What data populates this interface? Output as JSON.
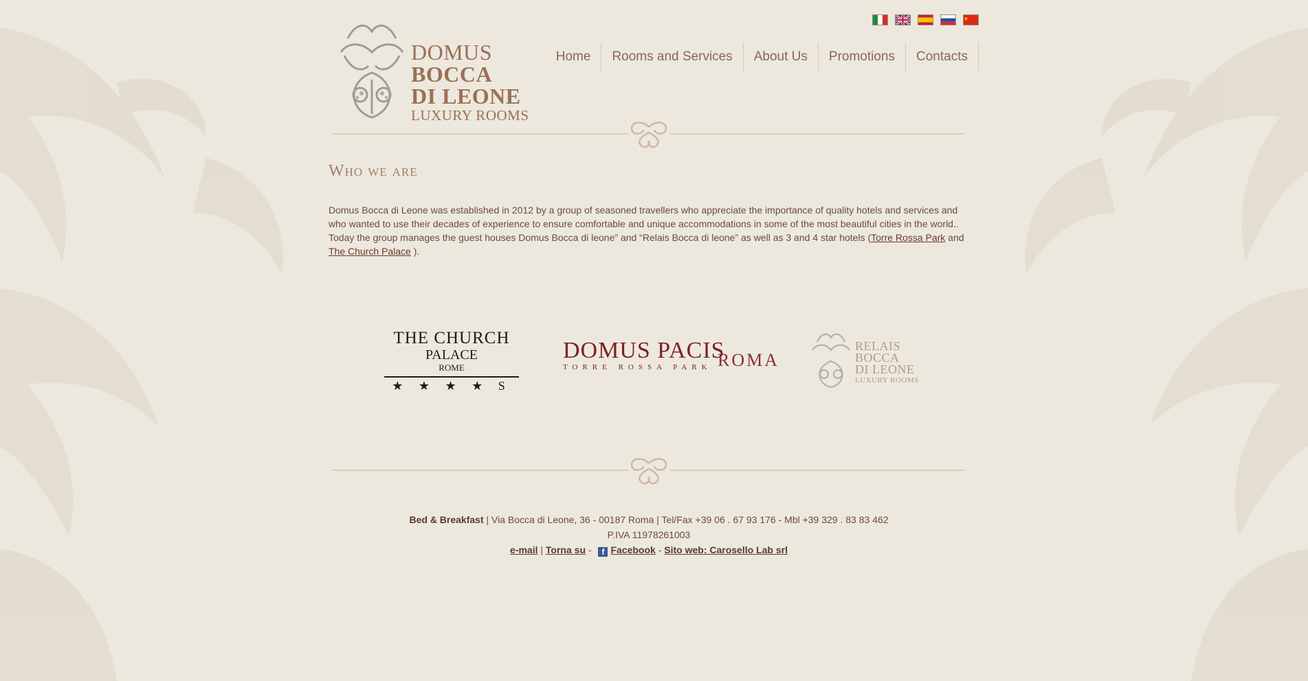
{
  "logo": {
    "line1": "DOMUS",
    "line2": "BOCCA",
    "line3": "DI LEONE",
    "line4": "LUXURY ROOMS"
  },
  "languages": [
    "Italiano",
    "English",
    "Español",
    "Русский",
    "中文"
  ],
  "nav": {
    "items": [
      "Home",
      "Rooms and Services",
      "About Us",
      "Promotions",
      "Contacts"
    ]
  },
  "about": {
    "heading": "Who we are",
    "text_1": "Domus Bocca di Leone was established in 2012 by a group of seasoned travellers who appreciate the importance of quality hotels and services and who wanted to use their decades of experience to ensure comfortable and unique accommodations in some of the most beautiful cities in the world.. Today the group manages the guest houses Domus Bocca di leone” and “Relais Bocca di leone” as well as 3 and 4 star hotels (",
    "link_1": "Torre Rossa Park",
    "text_2": " and ",
    "link_2": "The Church Palace",
    "text_3": " )."
  },
  "partners": {
    "church": {
      "line1": "THE CHURCH",
      "line2": "PALACE",
      "line3": "ROME",
      "stars": "★ ★ ★ ★ S"
    },
    "pacis": {
      "name": "DOMUS PACIS",
      "sub": "TORRE ROSSA PARK",
      "city": "ROMA"
    },
    "relais": {
      "line1": "RELAIS",
      "line2": "BOCCA",
      "line3": "DI LEONE",
      "line4": "LUXURY ROOMS"
    }
  },
  "footer": {
    "type_label": "Bed & Breakfast",
    "address": " | Via Bocca di Leone, 36 - 00187 Roma | Tel/Fax +39 06 . 67 93 176 - Mbl +39 329 . 83 83 462",
    "vat": "P.IVA 11978261003",
    "email": "e-mail",
    "sep1": " | ",
    "top": "Torna su",
    "sep2": " - ",
    "facebook": "Facebook",
    "sep3": " - ",
    "site": "Sito web: Carosello Lab srl"
  },
  "colors": {
    "background": "#ede8dd",
    "text": "#6b4a3c",
    "accent": "#9a7056",
    "link": "#6b3a2a"
  }
}
